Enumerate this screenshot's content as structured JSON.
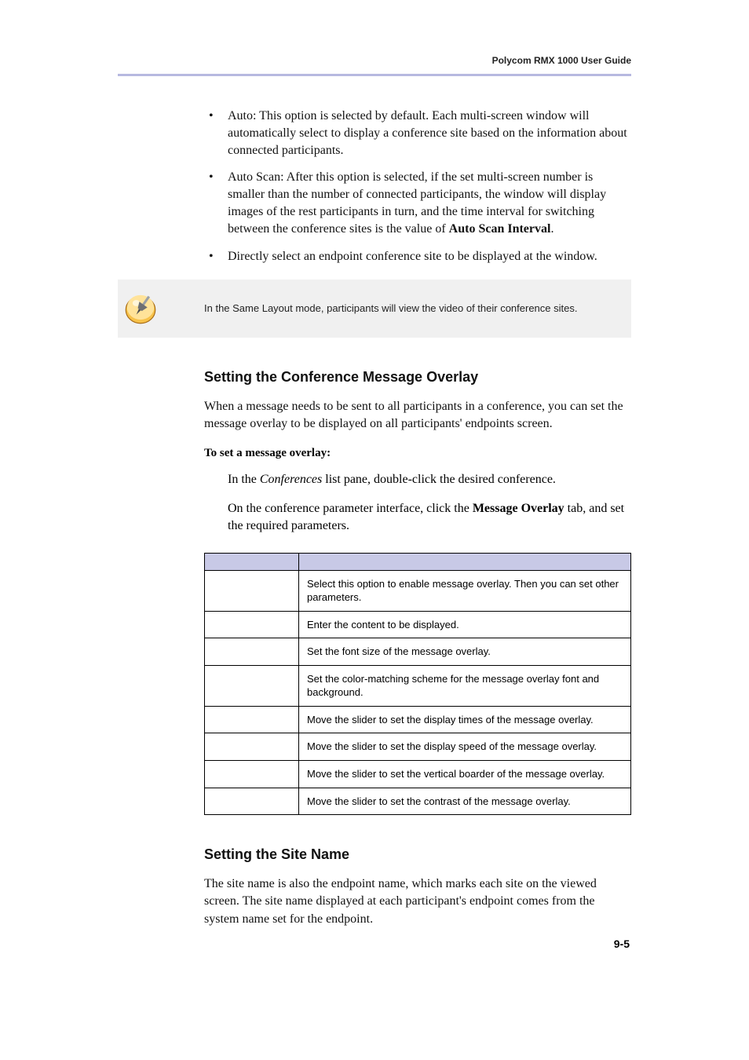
{
  "header": {
    "title": "Polycom RMX 1000 User Guide"
  },
  "bullets": [
    {
      "prefix": "Auto: ",
      "text": "This option is selected by default. Each multi-screen window will automatically select to display a conference site based on the information about connected participants."
    },
    {
      "prefix": "Auto Scan: ",
      "text_a": "After this option is selected, if the set multi-screen number is smaller than the number of connected participants, the window will display images of the rest participants in turn, and the time interval for switching between the conference sites is the value of ",
      "bold": "Auto Scan Interval",
      "text_b": "."
    },
    {
      "prefix": "",
      "text": "Directly select an endpoint conference site to be displayed at the window."
    }
  ],
  "note": {
    "text": "In the Same Layout mode, participants will view the video of their conference sites."
  },
  "section1": {
    "title": "Setting the Conference Message Overlay",
    "intro": "When a message needs to be sent to all participants in a conference, you can set the message overlay to be displayed on all participants' endpoints screen.",
    "sub": "To set a message overlay:",
    "step1_a": "In the ",
    "step1_i": "Conferences",
    "step1_b": " list pane, double-click the desired conference.",
    "step2_a": "On the conference parameter interface, click the ",
    "step2_bold": "Message Overlay",
    "step2_b": " tab, and set the required parameters."
  },
  "table": {
    "header": [
      "",
      ""
    ],
    "rows": [
      [
        "",
        "Select this option to enable message overlay. Then you can set other parameters."
      ],
      [
        "",
        "Enter the content to be displayed."
      ],
      [
        "",
        "Set the font size of the message overlay."
      ],
      [
        "",
        "Set the color-matching scheme for the message overlay font and background."
      ],
      [
        "",
        "Move the slider to set the display times of the message overlay."
      ],
      [
        "",
        "Move the slider to set the display speed of the message overlay."
      ],
      [
        "",
        "Move the slider to set the vertical boarder of the message overlay."
      ],
      [
        "",
        "Move the slider to set the contrast of the message overlay."
      ]
    ]
  },
  "section2": {
    "title": "Setting the Site Name",
    "body": "The site name is also the endpoint name, which marks each site on the viewed screen. The site name displayed at each participant's endpoint comes from the system name set for the endpoint."
  },
  "page_number": "9-5"
}
